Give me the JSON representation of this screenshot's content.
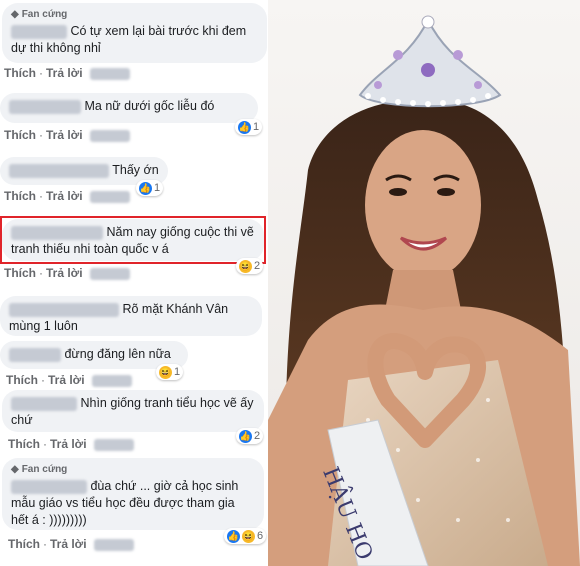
{
  "comments": [
    {
      "badge": "Fan cứng",
      "text": "Có tự xem lại bài trước khi đem dự thi không nhỉ",
      "actions": {
        "like": "Thích",
        "reply": "Trả lời"
      }
    },
    {
      "text": "Ma nữ dưới gốc liễu đó",
      "actions": {
        "like": "Thích",
        "reply": "Trả lời"
      },
      "reactions": {
        "icons": [
          "haha-icon",
          "like-icon"
        ],
        "count": "1"
      }
    },
    {
      "text": "Thấy ớn",
      "actions": {
        "like": "Thích",
        "reply": "Trả lời"
      },
      "reactions": {
        "icons": [
          "like-icon"
        ],
        "count": "1"
      }
    },
    {
      "text": "Năm nay giống cuộc thi vẽ tranh thiếu nhi toàn quốc v á",
      "highlighted": true,
      "actions": {
        "like": "Thích",
        "reply": "Trả lời"
      },
      "reactions": {
        "icons": [
          "haha-icon"
        ],
        "count": "2"
      }
    },
    {
      "text": "Rõ mặt Khánh Vân mùng 1 luôn"
    },
    {
      "text": "đừng đăng lên nữa",
      "actions": {
        "like": "Thích",
        "reply": "Trả lời"
      },
      "reactions": {
        "icons": [
          "haha-icon"
        ],
        "count": "1"
      }
    },
    {
      "text": "Nhìn giống tranh tiểu học vẽ ấy chứ",
      "actions": {
        "like": "Thích",
        "reply": "Trả lời"
      },
      "reactions": {
        "icons": [
          "like-icon"
        ],
        "count": "2"
      }
    },
    {
      "badge": "Fan cứng",
      "text": "đùa chứ ... giờ cả học sinh mẫu giáo vs tiểu học đều được tham gia hết á : )))))))))",
      "actions": {
        "like": "Thích",
        "reply": "Trả lời"
      },
      "reactions": {
        "icons": [
          "like-icon",
          "haha-icon"
        ],
        "count": "6"
      }
    }
  ],
  "photo": {
    "sash_text": "HẬU HO"
  },
  "colors": {
    "highlight": "#e0242a",
    "like": "#1877f2",
    "haha": "#f7b928",
    "bubble": "#f0f2f5"
  }
}
